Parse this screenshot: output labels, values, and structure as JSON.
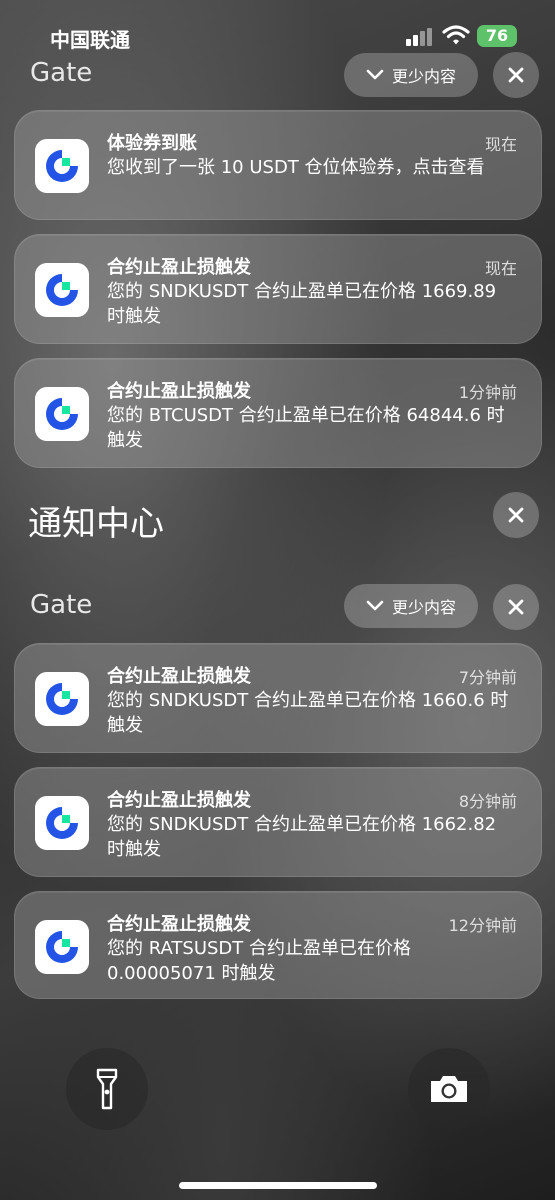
{
  "status_bar": {
    "carrier": "中国联通",
    "battery": "76"
  },
  "top_group": {
    "app_name": "Gate",
    "less_label": "更少内容",
    "notifications": [
      {
        "title": "体验券到账",
        "time": "现在",
        "body": "您收到了一张 10 USDT 仓位体验券，点击查看"
      },
      {
        "title": "合约止盈止损触发",
        "time": "现在",
        "body": "您的 SNDKUSDT 合约止盈单已在价格 1669.89 时触发"
      },
      {
        "title": "合约止盈止损触发",
        "time": "1分钟前",
        "body": "您的 BTCUSDT 合约止盈单已在价格 64844.6 时触发"
      }
    ]
  },
  "notification_center": {
    "title": "通知中心"
  },
  "center_group": {
    "app_name": "Gate",
    "less_label": "更少内容",
    "notifications": [
      {
        "title": "合约止盈止损触发",
        "time": "7分钟前",
        "body": "您的 SNDKUSDT 合约止盈单已在价格 1660.6 时触发"
      },
      {
        "title": "合约止盈止损触发",
        "time": "8分钟前",
        "body": "您的 SNDKUSDT 合约止盈单已在价格 1662.82 时触发"
      },
      {
        "title": "合约止盈止损触发",
        "time": "12分钟前",
        "body": "您的 RATSUSDT 合约止盈单已在价格 0.00005071 时触发"
      }
    ]
  },
  "icons": {
    "app": "gate-logo-icon",
    "collapse": "chevron-down-icon",
    "dismiss": "close-icon",
    "flashlight": "flashlight-icon",
    "camera": "camera-icon"
  },
  "colors": {
    "battery_green": "#5ec26a",
    "gate_blue": "#2354e6",
    "gate_green": "#17e6a1"
  }
}
